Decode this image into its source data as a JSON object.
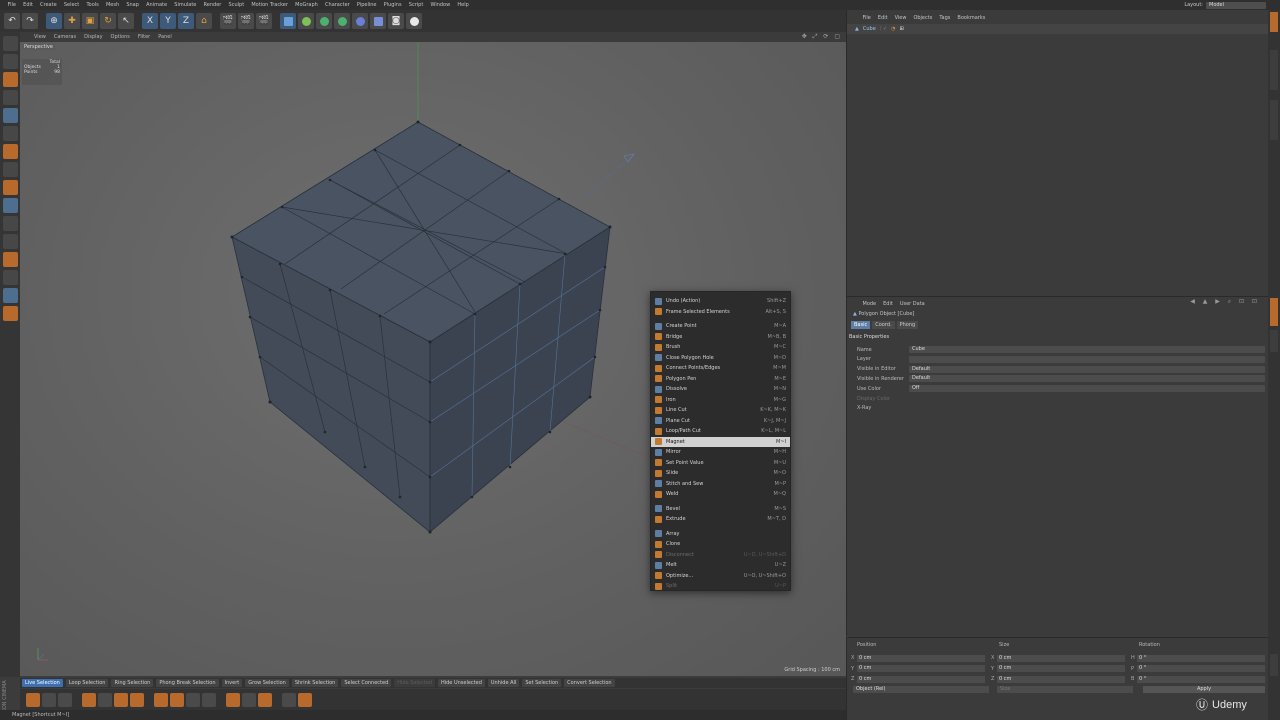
{
  "menubar": [
    "File",
    "Edit",
    "Create",
    "Select",
    "Tools",
    "Mesh",
    "Snap",
    "Animate",
    "Simulate",
    "Render",
    "Sculpt",
    "Motion Tracker",
    "MoGraph",
    "Character",
    "Pipeline",
    "Plugins",
    "Script",
    "Window",
    "Help"
  ],
  "layout": {
    "label": "Layout:",
    "value": "Model"
  },
  "toolbar": {
    "x_label": "X",
    "y_label": "Y",
    "z_label": "Z"
  },
  "viewport": {
    "menu": [
      "View",
      "Cameras",
      "Display",
      "Options",
      "Filter",
      "Panel"
    ],
    "camera": "Perspective",
    "stats_header": "Total",
    "stats": [
      {
        "k": "Objects",
        "v": "1"
      },
      {
        "k": "Points",
        "v": "98"
      }
    ],
    "grid_spacing": "Grid Spacing : 100 cm"
  },
  "context_menu": [
    {
      "label": "Undo (Action)",
      "shortcut": "Shift+Z",
      "icon": "undo-icon"
    },
    {
      "label": "Frame Selected Elements",
      "shortcut": "Alt+S, S",
      "icon": "frame-icon"
    },
    {
      "sep": true
    },
    {
      "label": "Create Point",
      "shortcut": "M~A",
      "icon": "create-point-icon"
    },
    {
      "label": "Bridge",
      "shortcut": "M~B, B",
      "icon": "bridge-icon"
    },
    {
      "label": "Brush",
      "shortcut": "M~C",
      "icon": "brush-icon"
    },
    {
      "label": "Close Polygon Hole",
      "shortcut": "M~D",
      "icon": "close-hole-icon"
    },
    {
      "label": "Connect Points/Edges",
      "shortcut": "M~M",
      "icon": "connect-icon"
    },
    {
      "label": "Polygon Pen",
      "shortcut": "M~E",
      "icon": "polygon-pen-icon"
    },
    {
      "label": "Dissolve",
      "shortcut": "M~N",
      "icon": "dissolve-icon"
    },
    {
      "label": "Iron",
      "shortcut": "M~G",
      "icon": "iron-icon"
    },
    {
      "label": "Line Cut",
      "shortcut": "K~K, M~K",
      "icon": "line-cut-icon"
    },
    {
      "label": "Plane Cut",
      "shortcut": "K~J, M~J",
      "icon": "plane-cut-icon"
    },
    {
      "label": "Loop/Path Cut",
      "shortcut": "K~L, M~L",
      "icon": "loop-cut-icon"
    },
    {
      "label": "Magnet",
      "shortcut": "M~I",
      "icon": "magnet-icon",
      "highlight": true
    },
    {
      "label": "Mirror",
      "shortcut": "M~H",
      "icon": "mirror-icon"
    },
    {
      "label": "Set Point Value",
      "shortcut": "M~U",
      "icon": "set-point-icon"
    },
    {
      "label": "Slide",
      "shortcut": "M~O",
      "icon": "slide-icon"
    },
    {
      "label": "Stitch and Sew",
      "shortcut": "M~P",
      "icon": "stitch-icon"
    },
    {
      "label": "Weld",
      "shortcut": "M~Q",
      "icon": "weld-icon"
    },
    {
      "sep": true
    },
    {
      "label": "Bevel",
      "shortcut": "M~S",
      "icon": "bevel-icon"
    },
    {
      "label": "Extrude",
      "shortcut": "M~T, D",
      "icon": "extrude-icon"
    },
    {
      "sep": true
    },
    {
      "label": "Array",
      "shortcut": "",
      "icon": "array-icon"
    },
    {
      "label": "Clone",
      "shortcut": "",
      "icon": "clone-icon"
    },
    {
      "label": "Disconnect",
      "shortcut": "U~D, U~Shift+D",
      "icon": "disconnect-icon",
      "dim": true
    },
    {
      "label": "Melt",
      "shortcut": "U~Z",
      "icon": "melt-icon"
    },
    {
      "label": "Optimize...",
      "shortcut": "U~O, U~Shift+O",
      "icon": "optimize-icon"
    },
    {
      "label": "Split",
      "shortcut": "U~P",
      "icon": "split-icon",
      "dim": true
    }
  ],
  "selection_bar": [
    {
      "label": "Live Selection",
      "active": true
    },
    {
      "label": "Loop Selection"
    },
    {
      "label": "Ring Selection"
    },
    {
      "label": "Phong Break Selection"
    },
    {
      "label": "Invert"
    },
    {
      "label": "Grow Selection"
    },
    {
      "label": "Shrink Selection"
    },
    {
      "label": "Select Connected"
    },
    {
      "label": "Hide Selected",
      "dim": true
    },
    {
      "label": "Hide Unselected"
    },
    {
      "label": "Unhide All"
    },
    {
      "label": "Set Selection"
    },
    {
      "label": "Convert Selection"
    }
  ],
  "status": "Magnet [Shortcut M~I]",
  "object_manager": {
    "menu": [
      "File",
      "Edit",
      "View",
      "Objects",
      "Tags",
      "Bookmarks"
    ],
    "object": "Cube"
  },
  "attributes": {
    "menu": [
      "Mode",
      "Edit",
      "User Data"
    ],
    "title": "Polygon Object [Cube]",
    "tabs": [
      {
        "label": "Basic",
        "active": true
      },
      {
        "label": "Coord."
      },
      {
        "label": "Phong"
      }
    ],
    "section": "Basic Properties",
    "props": [
      {
        "label": "Name",
        "value": "Cube"
      },
      {
        "label": "Layer",
        "value": ""
      },
      {
        "label": "Visible in Editor",
        "value": "Default"
      },
      {
        "label": "Visible in Renderer",
        "value": "Default"
      },
      {
        "label": "Use Color",
        "value": "Off"
      },
      {
        "label": "Display Color",
        "value": "",
        "dim": true
      },
      {
        "label": "X-Ray",
        "value": ""
      }
    ]
  },
  "coordinates": {
    "headers": [
      "Position",
      "Size",
      "Rotation"
    ],
    "rows": [
      {
        "ax": "X",
        "pos": "0 cm",
        "size": "0 cm",
        "rax": "H",
        "rot": "0 °"
      },
      {
        "ax": "Y",
        "pos": "0 cm",
        "size": "0 cm",
        "rax": "P",
        "rot": "0 °"
      },
      {
        "ax": "Z",
        "pos": "0 cm",
        "size": "0 cm",
        "rax": "B",
        "rot": "0 °"
      }
    ],
    "mode": "Object (Rel)",
    "size_mode": "Size",
    "apply": "Apply"
  },
  "watermark": "Udemy",
  "maxon": "MAXON CINEMA 4D"
}
